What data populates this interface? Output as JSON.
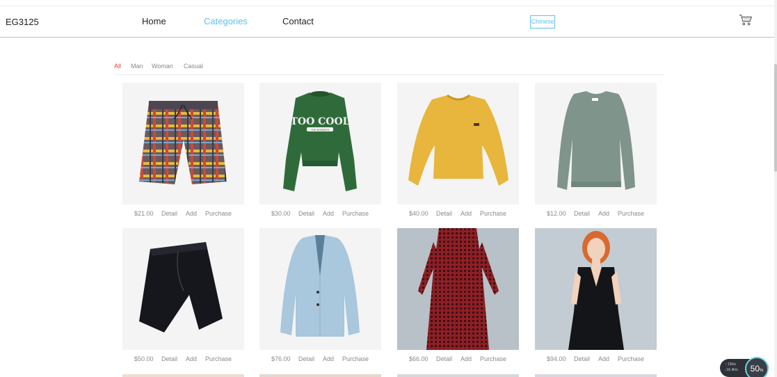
{
  "header": {
    "logo": "EG3125",
    "nav": [
      {
        "label": "Home",
        "active": false
      },
      {
        "label": "Categories",
        "active": true
      },
      {
        "label": "Contact",
        "active": false
      }
    ],
    "language_button": "Chinese",
    "cart_icon": "cart-icon"
  },
  "filters": [
    {
      "label": "All",
      "active": true
    },
    {
      "label": "Man",
      "active": false
    },
    {
      "label": "Woman",
      "active": false
    },
    {
      "label": "Casual",
      "active": false
    }
  ],
  "product_action_labels": {
    "detail": "Detail",
    "add": "Add",
    "purchase": "Purchase"
  },
  "products": [
    {
      "price": "$21.00",
      "item": "plaid-shorts"
    },
    {
      "price": "$30.00",
      "item": "green-sweatshirt",
      "graphic_text": "TOO COOL",
      "graphic_subtext": "THE MOMENTS"
    },
    {
      "price": "$40.00",
      "item": "yellow-sweater"
    },
    {
      "price": "$12.00",
      "item": "grey-sweater"
    },
    {
      "price": "$50.00",
      "item": "black-shorts"
    },
    {
      "price": "$76.00",
      "item": "denim-blazer"
    },
    {
      "price": "$66.00",
      "item": "red-check-dress"
    },
    {
      "price": "$94.00",
      "item": "black-wrap-dress"
    }
  ],
  "speed_widget": {
    "up": "↑ 13",
    "down": "↓16.4",
    "unit": "k/s",
    "percent": "50",
    "percent_sign": "%"
  },
  "colors": {
    "accent": "#5bc0eb",
    "filter_active": "#e83b3b"
  }
}
